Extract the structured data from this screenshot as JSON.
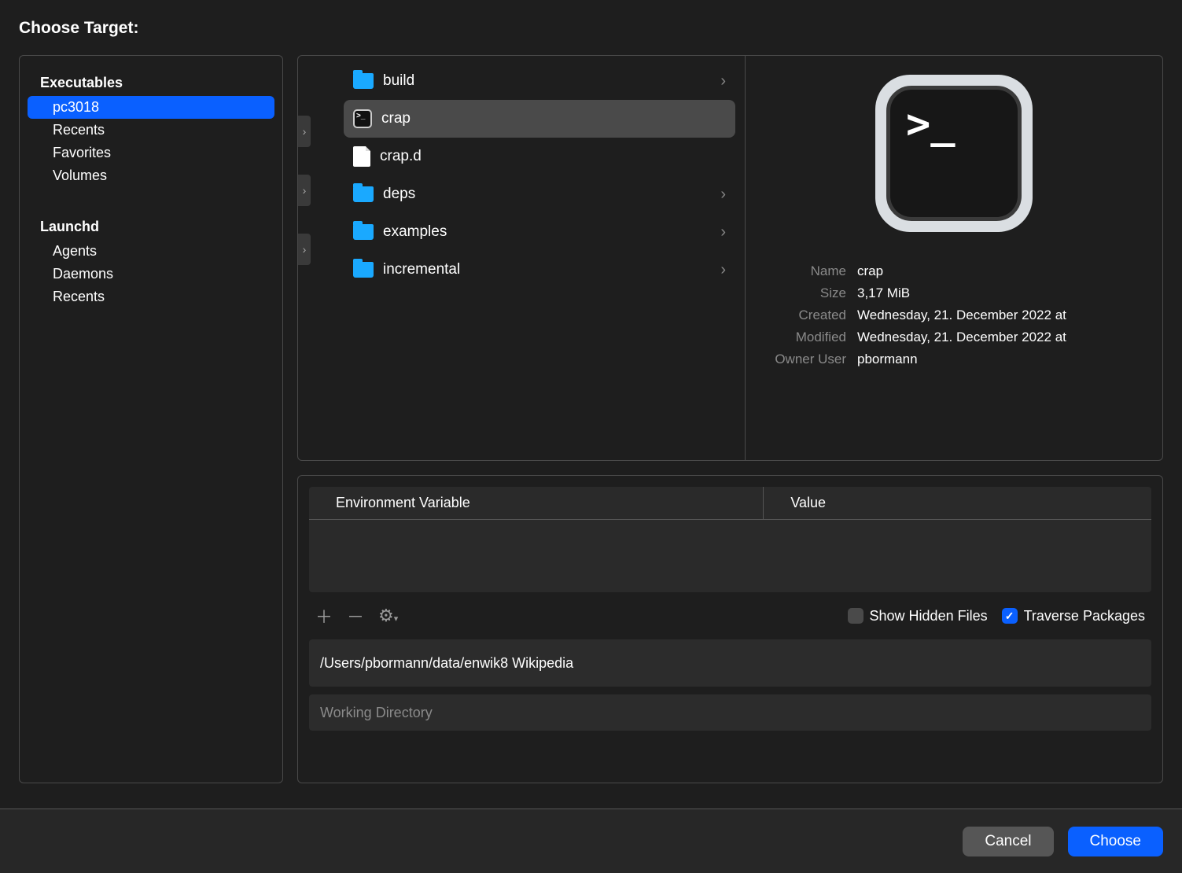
{
  "dialog_title": "Choose Target:",
  "sidebar": {
    "section1_title": "Executables",
    "section1_items": [
      "pc3018",
      "Recents",
      "Favorites",
      "Volumes"
    ],
    "section1_selected_index": 0,
    "section2_title": "Launchd",
    "section2_items": [
      "Agents",
      "Daemons",
      "Recents"
    ]
  },
  "files": [
    {
      "name": "build",
      "type": "folder",
      "has_children": true,
      "selected": false
    },
    {
      "name": "crap",
      "type": "exec",
      "has_children": false,
      "selected": true
    },
    {
      "name": "crap.d",
      "type": "doc",
      "has_children": false,
      "selected": false
    },
    {
      "name": "deps",
      "type": "folder",
      "has_children": true,
      "selected": false
    },
    {
      "name": "examples",
      "type": "folder",
      "has_children": true,
      "selected": false
    },
    {
      "name": "incremental",
      "type": "folder",
      "has_children": true,
      "selected": false
    }
  ],
  "preview": {
    "prompt_glyph": ">_",
    "meta": {
      "name_label": "Name",
      "name_value": "crap",
      "size_label": "Size",
      "size_value": "3,17 MiB",
      "created_label": "Created",
      "created_value": "Wednesday, 21. December 2022 at",
      "modified_label": "Modified",
      "modified_value": "Wednesday, 21. December 2022 at",
      "owner_label": "Owner User",
      "owner_value": "pbormann"
    }
  },
  "env_table": {
    "col1": "Environment Variable",
    "col2": "Value"
  },
  "toolbar": {
    "show_hidden_label": "Show Hidden Files",
    "show_hidden_checked": false,
    "traverse_label": "Traverse Packages",
    "traverse_checked": true
  },
  "arguments_value": "/Users/pbormann/data/enwik8 Wikipedia",
  "working_dir_placeholder": "Working Directory",
  "buttons": {
    "cancel": "Cancel",
    "choose": "Choose"
  }
}
